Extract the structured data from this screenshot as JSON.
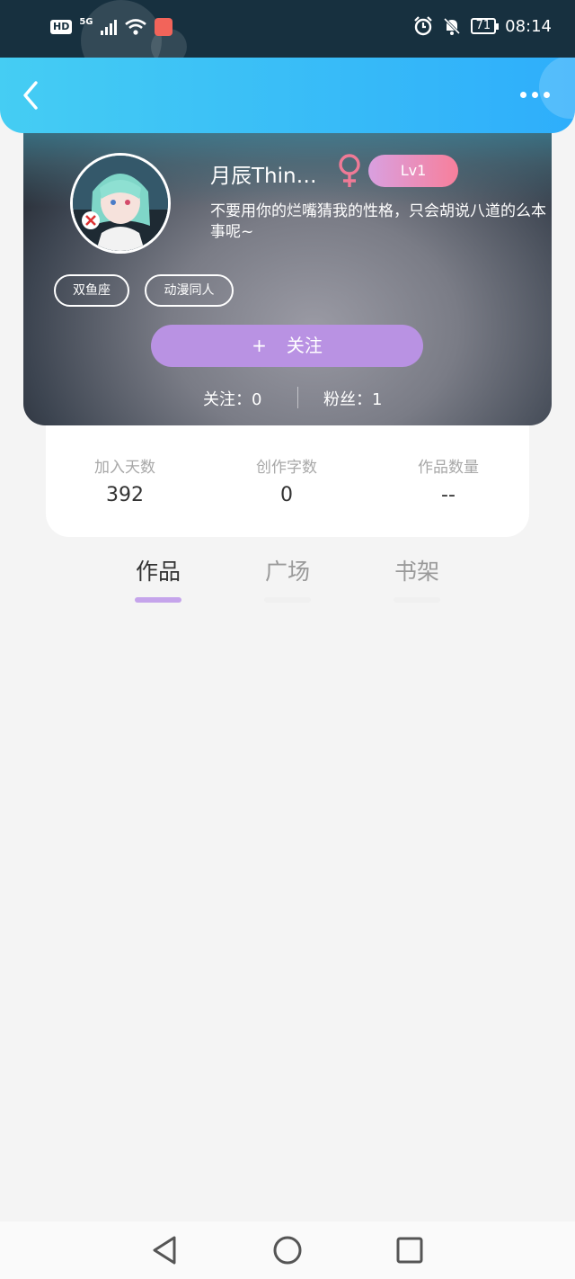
{
  "status_bar": {
    "hd": "HD",
    "network": "5G",
    "battery": "71",
    "time": "08:14"
  },
  "profile": {
    "username": "月辰Thin…",
    "gender": "female",
    "level": "Lv1",
    "bio": "不要用你的烂嘴猜我的性格，只会胡说八道的么本事呢~",
    "tags": [
      "双鱼座",
      "动漫同人"
    ],
    "follow_button": {
      "plus": "+",
      "label": "关注"
    },
    "following_label": "关注：0",
    "fans_label": "粉丝：1"
  },
  "stats": [
    {
      "label": "加入天数",
      "value": "392"
    },
    {
      "label": "创作字数",
      "value": "0"
    },
    {
      "label": "作品数量",
      "value": "--"
    }
  ],
  "tabs": [
    {
      "label": "作品",
      "active": true
    },
    {
      "label": "广场",
      "active": false
    },
    {
      "label": "书架",
      "active": false
    }
  ],
  "colors": {
    "header_start": "#45cdf3",
    "header_end": "#2eaefb",
    "follow_button": "#b992e3",
    "level_badge_start": "#d9a0e0",
    "level_badge_end": "#f77f9b",
    "active_tab_underline": "#c5a4eb",
    "female_icon": "#f07a96"
  },
  "icons": {
    "back": "chevron-left-icon",
    "more": "more-horizontal-icon",
    "gender": "female-icon",
    "alarm": "alarm-icon",
    "mute": "bell-off-icon",
    "wifi": "wifi-icon",
    "signal": "signal-icon"
  }
}
